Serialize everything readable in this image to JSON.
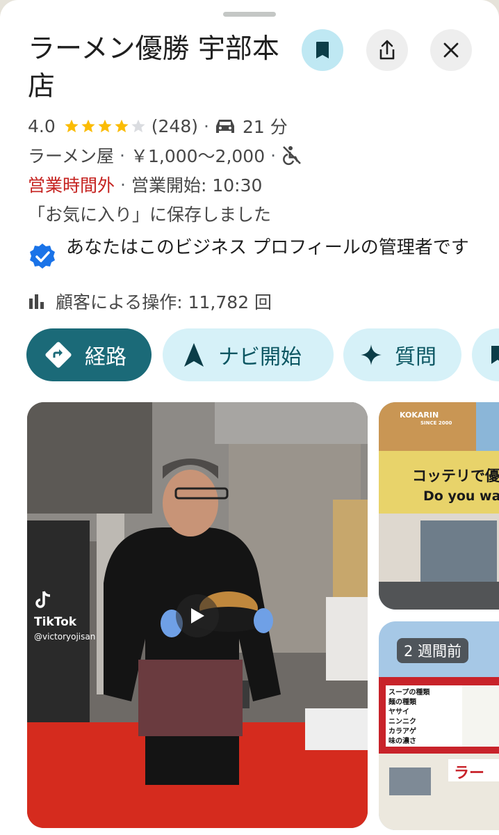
{
  "place": {
    "title": "ラーメン優勝 宇部本店",
    "rating": "4.0",
    "stars_filled": 4,
    "stars_total": 5,
    "review_count": "(248)",
    "drive_time": "21 分",
    "category": "ラーメン屋",
    "price": "￥1,000～2,000",
    "status": "営業時間外",
    "opening": "営業開始: 10:30",
    "saved_note": "「お気に入り」に保存しました",
    "verified_text": "あなたはこのビジネス プロフィールの管理者です",
    "interactions": "顧客による操作: 11,782 回",
    "separator": "·"
  },
  "buttons": {
    "route": "経路",
    "navigate": "ナビ開始",
    "ask": "質問"
  },
  "photos": {
    "video_brand": "TikTok",
    "video_user": "@victoryojisan",
    "side2_badge": "2 週間前",
    "store_sign_brand": "KOKARIN",
    "store_sign_since": "SINCE 2000",
    "store_sign_main": "コッテリで優勝",
    "store_sign_sub": "Do you want",
    "menu_board": [
      "スープの種類",
      "麺の種類",
      "ヤサイ",
      "ニンニク",
      "カラアゲ",
      "味の濃さ"
    ],
    "banner": "ラー"
  },
  "colors": {
    "accent": "#1b6a78",
    "chip_bg": "#d6f1f8",
    "closed_red": "#c5221f",
    "star": "#fbbc04",
    "verified_blue": "#1a73e8"
  },
  "icons": [
    "bookmark-icon",
    "share-icon",
    "close-icon",
    "car-icon",
    "not-accessible-icon",
    "verified-badge-icon",
    "bar-chart-icon",
    "directions-icon",
    "navigation-arrow-icon",
    "sparkle-icon",
    "play-icon",
    "tiktok-icon"
  ]
}
